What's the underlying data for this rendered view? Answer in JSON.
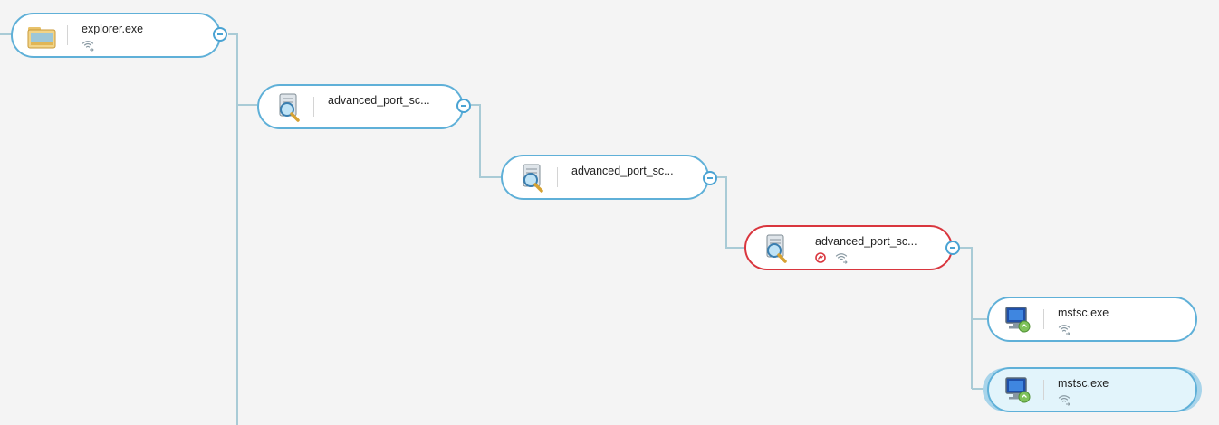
{
  "colors": {
    "background": "#f4f4f4",
    "node_border": "#5fb0d8",
    "node_alert_border": "#d9363e",
    "node_selected_fill": "#e2f4fb",
    "connector": "#a9cbd6"
  },
  "process_tree": {
    "nodes": [
      {
        "label": "explorer.exe",
        "icon": "folder-explorer-icon",
        "badges": [
          "network-icon"
        ],
        "alert": false,
        "selected": false,
        "collapse": "minus-icon"
      },
      {
        "label": "advanced_port_sc...",
        "icon": "port-scanner-icon",
        "badges": [],
        "alert": false,
        "selected": false,
        "collapse": "minus-icon"
      },
      {
        "label": "advanced_port_sc...",
        "icon": "port-scanner-icon",
        "badges": [],
        "alert": false,
        "selected": false,
        "collapse": "minus-icon"
      },
      {
        "label": "advanced_port_sc...",
        "icon": "port-scanner-icon",
        "badges": [
          "malop-alert-icon",
          "network-icon"
        ],
        "alert": true,
        "selected": false,
        "collapse": "minus-icon"
      },
      {
        "label": "mstsc.exe",
        "icon": "remote-desktop-icon",
        "badges": [
          "network-icon"
        ],
        "alert": false,
        "selected": false
      },
      {
        "label": "mstsc.exe",
        "icon": "remote-desktop-icon",
        "badges": [
          "network-icon"
        ],
        "alert": false,
        "selected": true
      }
    ]
  }
}
